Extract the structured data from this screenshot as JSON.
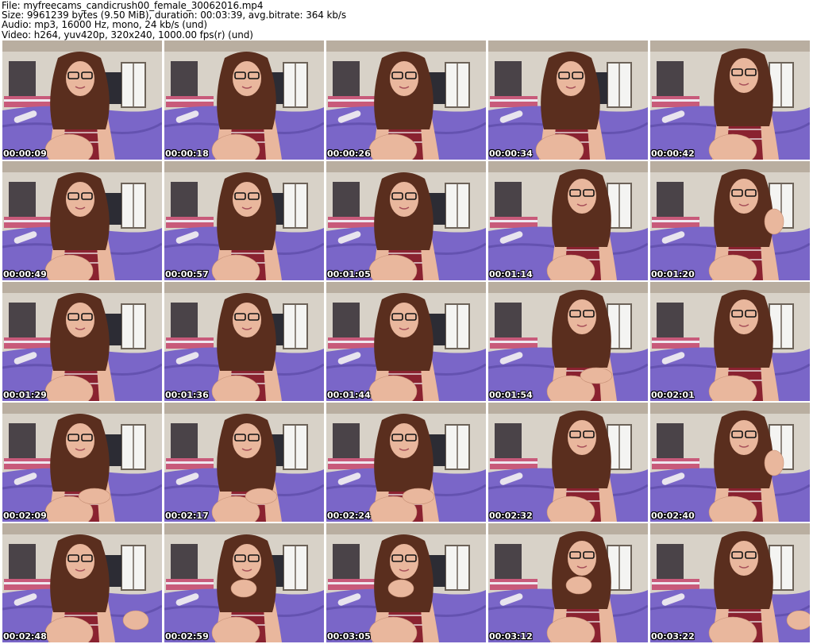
{
  "header": {
    "file": "File: myfreecams_candicrush00_female_30062016.mp4",
    "size": "Size: 9961239 bytes (9.50 MiB), duration: 00:03:39, avg.bitrate: 364 kb/s",
    "audio": "Audio: mp3, 16000 Hz, mono, 24 kb/s (und)",
    "video": "Video: h264, yuv420p, 320x240, 1000.00 fps(r) (und)"
  },
  "frames": [
    {
      "time": "00:00:09",
      "pose": "lean",
      "hand": "none"
    },
    {
      "time": "00:00:18",
      "pose": "lean",
      "hand": "none"
    },
    {
      "time": "00:00:26",
      "pose": "lean",
      "hand": "none"
    },
    {
      "time": "00:00:34",
      "pose": "lean",
      "hand": "none"
    },
    {
      "time": "00:00:42",
      "pose": "sit",
      "hand": "none"
    },
    {
      "time": "00:00:49",
      "pose": "lean",
      "hand": "none"
    },
    {
      "time": "00:00:57",
      "pose": "lean",
      "hand": "none"
    },
    {
      "time": "00:01:05",
      "pose": "lean",
      "hand": "none"
    },
    {
      "time": "00:01:14",
      "pose": "sit",
      "hand": "none"
    },
    {
      "time": "00:01:20",
      "pose": "sit",
      "hand": "face"
    },
    {
      "time": "00:01:29",
      "pose": "lean",
      "hand": "none"
    },
    {
      "time": "00:01:36",
      "pose": "lean",
      "hand": "none"
    },
    {
      "time": "00:01:44",
      "pose": "lean",
      "hand": "none"
    },
    {
      "time": "00:01:54",
      "pose": "sit",
      "hand": "knee"
    },
    {
      "time": "00:02:01",
      "pose": "sit",
      "hand": "none"
    },
    {
      "time": "00:02:09",
      "pose": "lean",
      "hand": "knee"
    },
    {
      "time": "00:02:17",
      "pose": "lean",
      "hand": "knee"
    },
    {
      "time": "00:02:24",
      "pose": "lean",
      "hand": "knee"
    },
    {
      "time": "00:02:32",
      "pose": "sit",
      "hand": "none"
    },
    {
      "time": "00:02:40",
      "pose": "sit",
      "hand": "face"
    },
    {
      "time": "00:02:48",
      "pose": "lean",
      "hand": "wave"
    },
    {
      "time": "00:02:59",
      "pose": "lean",
      "hand": "chin"
    },
    {
      "time": "00:03:05",
      "pose": "lean",
      "hand": "chin"
    },
    {
      "time": "00:03:12",
      "pose": "sit",
      "hand": "chin"
    },
    {
      "time": "00:03:22",
      "pose": "sit",
      "hand": "wave"
    }
  ],
  "colors": {
    "wall": "#d8d2c8",
    "blanket": "#7a66c8",
    "skin": "#e9b79d",
    "hair": "#5a2e1e",
    "tank": "#8a2230",
    "window": "#f4f4f2",
    "board": "#2c2c34"
  }
}
